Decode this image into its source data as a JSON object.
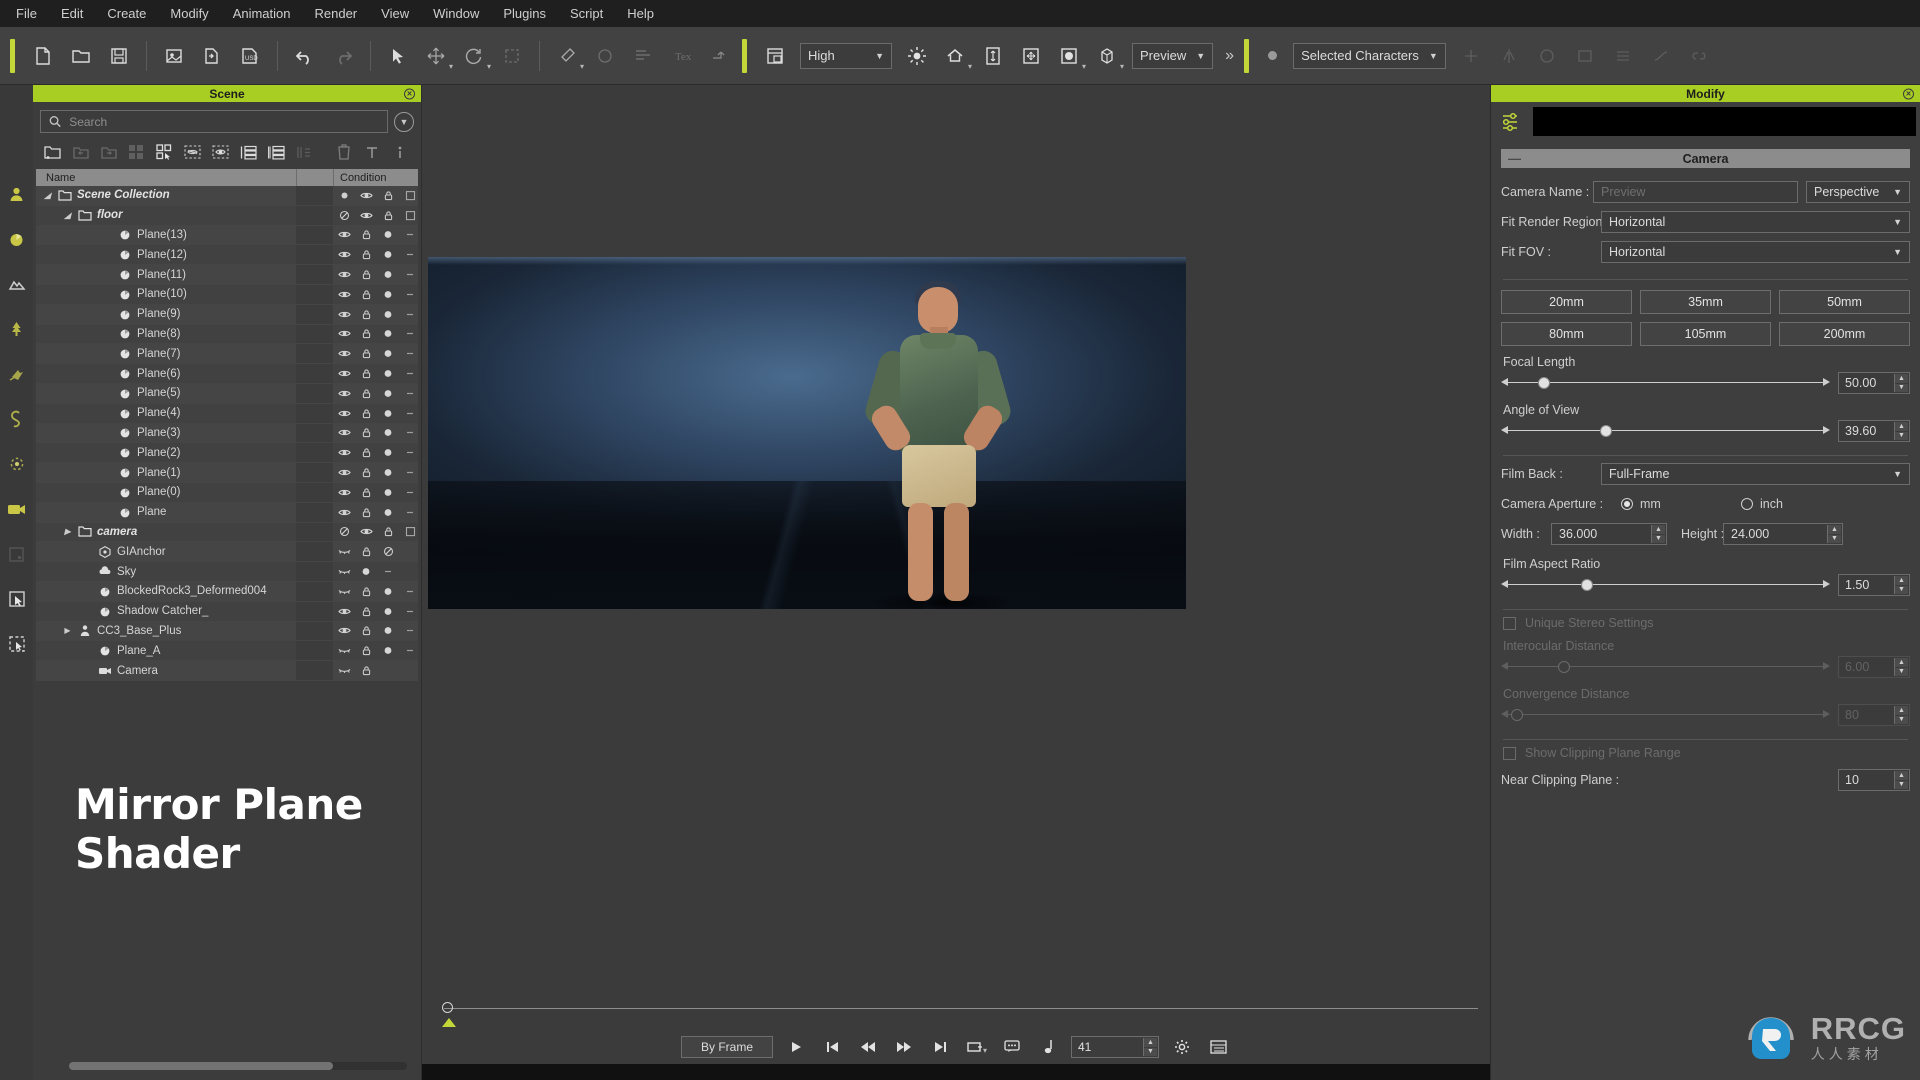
{
  "menu": {
    "items": [
      "File",
      "Edit",
      "Create",
      "Modify",
      "Animation",
      "Render",
      "View",
      "Window",
      "Plugins",
      "Script",
      "Help"
    ]
  },
  "toolbar": {
    "quality_value": "High",
    "preview_value": "Preview",
    "character_filter_value": "Selected Characters",
    "overflow_label": "»",
    "icons": [
      "new-file-icon",
      "open-folder-icon",
      "save-icon",
      "import-image-icon",
      "export-icon",
      "usd-icon",
      "undo-icon",
      "redo-icon",
      "select-arrow-icon",
      "move-icon",
      "rotate-icon",
      "scale-icon",
      "brush-icon",
      "paint-icon",
      "align-icon",
      "text-icon",
      "transform-icon",
      "layout-icon",
      "light-icon",
      "home-icon",
      "height-icon",
      "move-all-icon",
      "sphere-icon",
      "box-icon"
    ]
  },
  "rail": {
    "items": [
      {
        "name": "character-icon",
        "active": true
      },
      {
        "name": "prop-icon",
        "active": true
      },
      {
        "name": "terrain-icon",
        "active": false
      },
      {
        "name": "tree-icon",
        "active": true
      },
      {
        "name": "particle-icon",
        "active": false
      },
      {
        "name": "path-icon",
        "active": false
      },
      {
        "name": "physics-icon",
        "active": false
      },
      {
        "name": "camera-icon",
        "active": true
      },
      {
        "name": "image-plane-icon",
        "active": false
      },
      {
        "name": "select-region-icon",
        "active": false
      },
      {
        "name": "marquee-icon",
        "active": false
      }
    ]
  },
  "scene_panel": {
    "title": "Scene",
    "close_label": "×",
    "search_placeholder": "Search",
    "search_value": "",
    "filter_button": "chevron-down-circle-icon",
    "tree_toolbar": [
      "add-folder-icon",
      "indent-left-icon",
      "indent-right-icon",
      "group-icon",
      "select-group-icon",
      "hide-mesh-icon",
      "show-mesh-icon",
      "expand-list-icon",
      "collapse-list-icon",
      "columns-icon",
      "delete-icon",
      "text-tool-icon",
      "info-icon"
    ],
    "columns": {
      "name": "Name",
      "condition": "Condition"
    },
    "tree": [
      {
        "label": "Scene Collection",
        "depth": 0,
        "icon": "folder-icon",
        "twisty": "down",
        "italic": true,
        "cond": [
          "dot",
          "eye",
          "lock",
          "box"
        ]
      },
      {
        "label": "floor",
        "depth": 1,
        "icon": "folder-icon",
        "twisty": "down",
        "italic": true,
        "cond": [
          "no",
          "eye",
          "lock",
          "box"
        ]
      },
      {
        "label": "Plane(13)",
        "depth": 3,
        "icon": "mesh-icon",
        "twisty": "",
        "italic": false,
        "cond": [
          "eye",
          "lock",
          "sphere",
          "dash"
        ]
      },
      {
        "label": "Plane(12)",
        "depth": 3,
        "icon": "mesh-icon",
        "twisty": "",
        "italic": false,
        "cond": [
          "eye",
          "lock",
          "sphere",
          "dash"
        ]
      },
      {
        "label": "Plane(11)",
        "depth": 3,
        "icon": "mesh-icon",
        "twisty": "",
        "italic": false,
        "cond": [
          "eye",
          "lock",
          "sphere",
          "dash"
        ]
      },
      {
        "label": "Plane(10)",
        "depth": 3,
        "icon": "mesh-icon",
        "twisty": "",
        "italic": false,
        "cond": [
          "eye",
          "lock",
          "sphere",
          "dash"
        ]
      },
      {
        "label": "Plane(9)",
        "depth": 3,
        "icon": "mesh-icon",
        "twisty": "",
        "italic": false,
        "cond": [
          "eye",
          "lock",
          "sphere",
          "dash"
        ]
      },
      {
        "label": "Plane(8)",
        "depth": 3,
        "icon": "mesh-icon",
        "twisty": "",
        "italic": false,
        "cond": [
          "eye",
          "lock",
          "sphere",
          "dash"
        ]
      },
      {
        "label": "Plane(7)",
        "depth": 3,
        "icon": "mesh-icon",
        "twisty": "",
        "italic": false,
        "cond": [
          "eye",
          "lock",
          "sphere",
          "dash"
        ]
      },
      {
        "label": "Plane(6)",
        "depth": 3,
        "icon": "mesh-icon",
        "twisty": "",
        "italic": false,
        "cond": [
          "eye",
          "lock",
          "sphere",
          "dash"
        ]
      },
      {
        "label": "Plane(5)",
        "depth": 3,
        "icon": "mesh-icon",
        "twisty": "",
        "italic": false,
        "cond": [
          "eye",
          "lock",
          "sphere",
          "dash"
        ]
      },
      {
        "label": "Plane(4)",
        "depth": 3,
        "icon": "mesh-icon",
        "twisty": "",
        "italic": false,
        "cond": [
          "eye",
          "lock",
          "sphere",
          "dash"
        ]
      },
      {
        "label": "Plane(3)",
        "depth": 3,
        "icon": "mesh-icon",
        "twisty": "",
        "italic": false,
        "cond": [
          "eye",
          "lock",
          "sphere",
          "dash"
        ]
      },
      {
        "label": "Plane(2)",
        "depth": 3,
        "icon": "mesh-icon",
        "twisty": "",
        "italic": false,
        "cond": [
          "eye",
          "lock",
          "sphere",
          "dash"
        ]
      },
      {
        "label": "Plane(1)",
        "depth": 3,
        "icon": "mesh-icon",
        "twisty": "",
        "italic": false,
        "cond": [
          "eye",
          "lock",
          "sphere",
          "dash"
        ]
      },
      {
        "label": "Plane(0)",
        "depth": 3,
        "icon": "mesh-icon",
        "twisty": "",
        "italic": false,
        "cond": [
          "eye",
          "lock",
          "sphere",
          "dash"
        ]
      },
      {
        "label": "Plane",
        "depth": 3,
        "icon": "mesh-icon",
        "twisty": "",
        "italic": false,
        "cond": [
          "eye",
          "lock",
          "sphere",
          "dash"
        ]
      },
      {
        "label": "camera",
        "depth": 1,
        "icon": "folder-icon",
        "twisty": "right",
        "italic": true,
        "cond": [
          "no",
          "eye",
          "lock",
          "box"
        ]
      },
      {
        "label": "GIAnchor",
        "depth": 2,
        "icon": "gizmo-icon",
        "twisty": "",
        "italic": false,
        "cond": [
          "eyeoff",
          "lock",
          "no"
        ]
      },
      {
        "label": "Sky",
        "depth": 2,
        "icon": "cloud-icon",
        "twisty": "",
        "italic": false,
        "cond": [
          "eyeoff",
          "sphere",
          "dash"
        ]
      },
      {
        "label": "BlockedRock3_Deformed004",
        "depth": 2,
        "icon": "mesh-icon",
        "twisty": "",
        "italic": false,
        "cond": [
          "eyeoff",
          "lock",
          "sphere",
          "dash"
        ]
      },
      {
        "label": "Shadow Catcher_",
        "depth": 2,
        "icon": "mesh-icon",
        "twisty": "",
        "italic": false,
        "cond": [
          "eye",
          "lock",
          "sphere",
          "dash"
        ]
      },
      {
        "label": "CC3_Base_Plus",
        "depth": 1,
        "icon": "person-icon",
        "twisty": "right",
        "italic": false,
        "cond": [
          "eye",
          "lock",
          "sphere",
          "dash"
        ]
      },
      {
        "label": "Plane_A",
        "depth": 2,
        "icon": "mesh-icon",
        "twisty": "",
        "italic": false,
        "cond": [
          "eyeoff",
          "lock",
          "sphere",
          "dash"
        ]
      },
      {
        "label": "Camera",
        "depth": 2,
        "icon": "camera-icon",
        "twisty": "",
        "italic": false,
        "cond": [
          "eyeoff",
          "lock"
        ]
      }
    ],
    "overlay_title": "Mirror Plane Shader"
  },
  "viewport": {
    "timeline": {
      "current_position_pct": 0.2
    },
    "playback": {
      "mode_label": "By Frame",
      "buttons": [
        "play-icon",
        "jump-to-start-icon",
        "step-back-icon",
        "step-forward-icon",
        "jump-to-end-icon",
        "range-icon",
        "comment-icon",
        "note-icon"
      ],
      "frame_value": "41",
      "settings_icon": "gear-icon",
      "timeline_icon": "timeline-icon"
    }
  },
  "modify_panel": {
    "title": "Modify",
    "close_label": "×",
    "tool_icon": "sliders-icon",
    "section": {
      "title": "Camera",
      "collapse_label": "—"
    },
    "camera": {
      "name_label": "Camera Name :",
      "name_placeholder": "Preview",
      "name_value": "",
      "projection_value": "Perspective",
      "fit_render_region_label": "Fit Render Region :",
      "fit_render_region_value": "Horizontal",
      "fit_fov_label": "Fit FOV :",
      "fit_fov_value": "Horizontal",
      "presets": [
        "20mm",
        "35mm",
        "50mm",
        "80mm",
        "105mm",
        "200mm"
      ],
      "focal_length_label": "Focal Length",
      "focal_length_value": "50.00",
      "focal_length_pct": 13,
      "angle_of_view_label": "Angle of View",
      "angle_of_view_value": "39.60",
      "angle_of_view_pct": 32,
      "film_back_label": "Film Back :",
      "film_back_value": "Full-Frame",
      "aperture_label": "Camera Aperture :",
      "aperture_unit_mm": "mm",
      "aperture_unit_inch": "inch",
      "aperture_selected": "mm",
      "width_label": "Width :",
      "width_value": "36.000",
      "height_label": "Height :",
      "height_value": "24.000",
      "film_aspect_label": "Film Aspect Ratio",
      "film_aspect_value": "1.50",
      "film_aspect_pct": 26,
      "unique_stereo_label": "Unique Stereo Settings",
      "unique_stereo_checked": false,
      "interocular_label": "Interocular Distance",
      "interocular_value": "6.00",
      "interocular_pct": 19,
      "convergence_label": "Convergence Distance",
      "convergence_value": "80",
      "convergence_pct": 5,
      "show_clipping_label": "Show Clipping Plane Range",
      "show_clipping_checked": false,
      "near_clipping_label": "Near Clipping Plane :",
      "near_clipping_value": "10"
    }
  },
  "watermark": {
    "brand": "RRCG",
    "sub": "人人素材"
  },
  "colors": {
    "accent": "#a8ce24",
    "panel_bg": "#3e3e3e",
    "header_gray": "#8c8c8c",
    "menu_bg": "#1f1f1f"
  }
}
